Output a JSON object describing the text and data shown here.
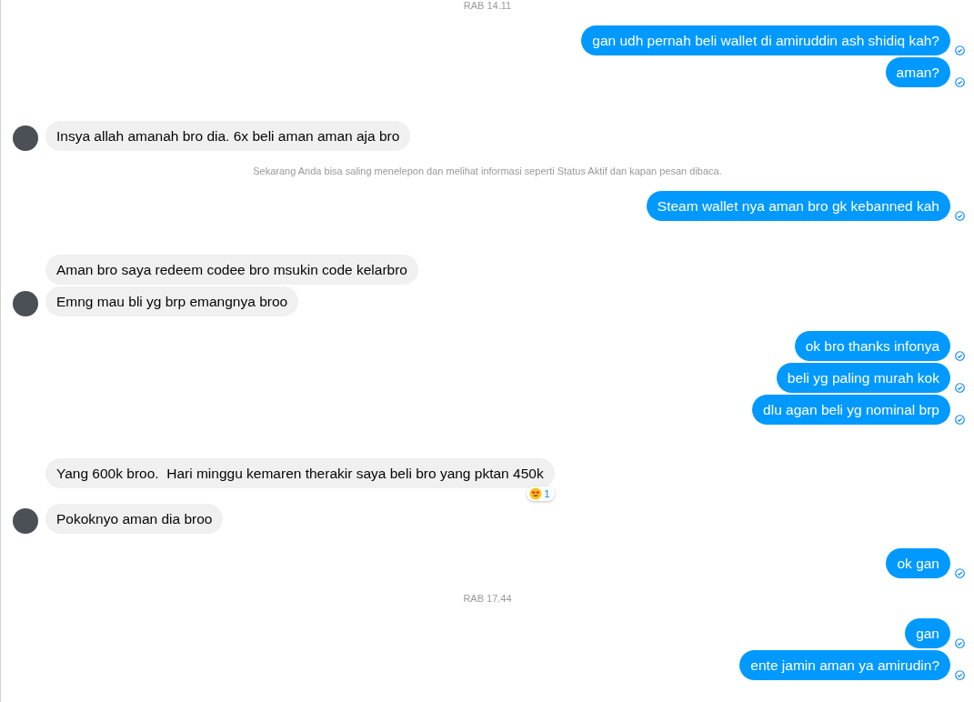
{
  "thread": [
    {
      "kind": "time",
      "text": "RAB 14.11"
    },
    {
      "kind": "sent",
      "messages": [
        {
          "text": "gan udh pernah beli wallet di amiruddin ash shidiq kah?"
        },
        {
          "text": "aman?"
        }
      ]
    },
    {
      "kind": "received",
      "messages": [
        {
          "text": "Insya allah amanah bro dia. 6x beli aman aman aja bro"
        }
      ]
    },
    {
      "kind": "notice",
      "text": "Sekarang Anda bisa saling menelepon dan melihat informasi seperti Status Aktif dan kapan pesan dibaca."
    },
    {
      "kind": "sent",
      "messages": [
        {
          "text": "Steam wallet nya aman bro gk kebanned kah"
        }
      ]
    },
    {
      "kind": "received",
      "messages": [
        {
          "text": "Aman bro saya redeem codee bro msukin code kelarbro"
        },
        {
          "text": "Emng mau bli yg brp emangnya broo"
        }
      ]
    },
    {
      "kind": "sent",
      "messages": [
        {
          "text": "ok bro thanks infonya"
        },
        {
          "text": "beli yg paling murah kok"
        },
        {
          "text": "dlu agan beli yg nominal brp"
        }
      ]
    },
    {
      "kind": "received",
      "messages": [
        {
          "text": "Yang 600k broo.  Hari minggu kemaren therakir saya beli bro yang pktan 450k",
          "reaction": {
            "count": "1"
          }
        },
        {
          "text": "Pokoknyo aman dia broo"
        }
      ]
    },
    {
      "kind": "sent",
      "messages": [
        {
          "text": "ok gan"
        }
      ]
    },
    {
      "kind": "time",
      "text": "RAB 17.44"
    },
    {
      "kind": "sent",
      "messages": [
        {
          "text": "gan"
        },
        {
          "text": "ente jamin aman ya amirudin?"
        }
      ]
    }
  ]
}
